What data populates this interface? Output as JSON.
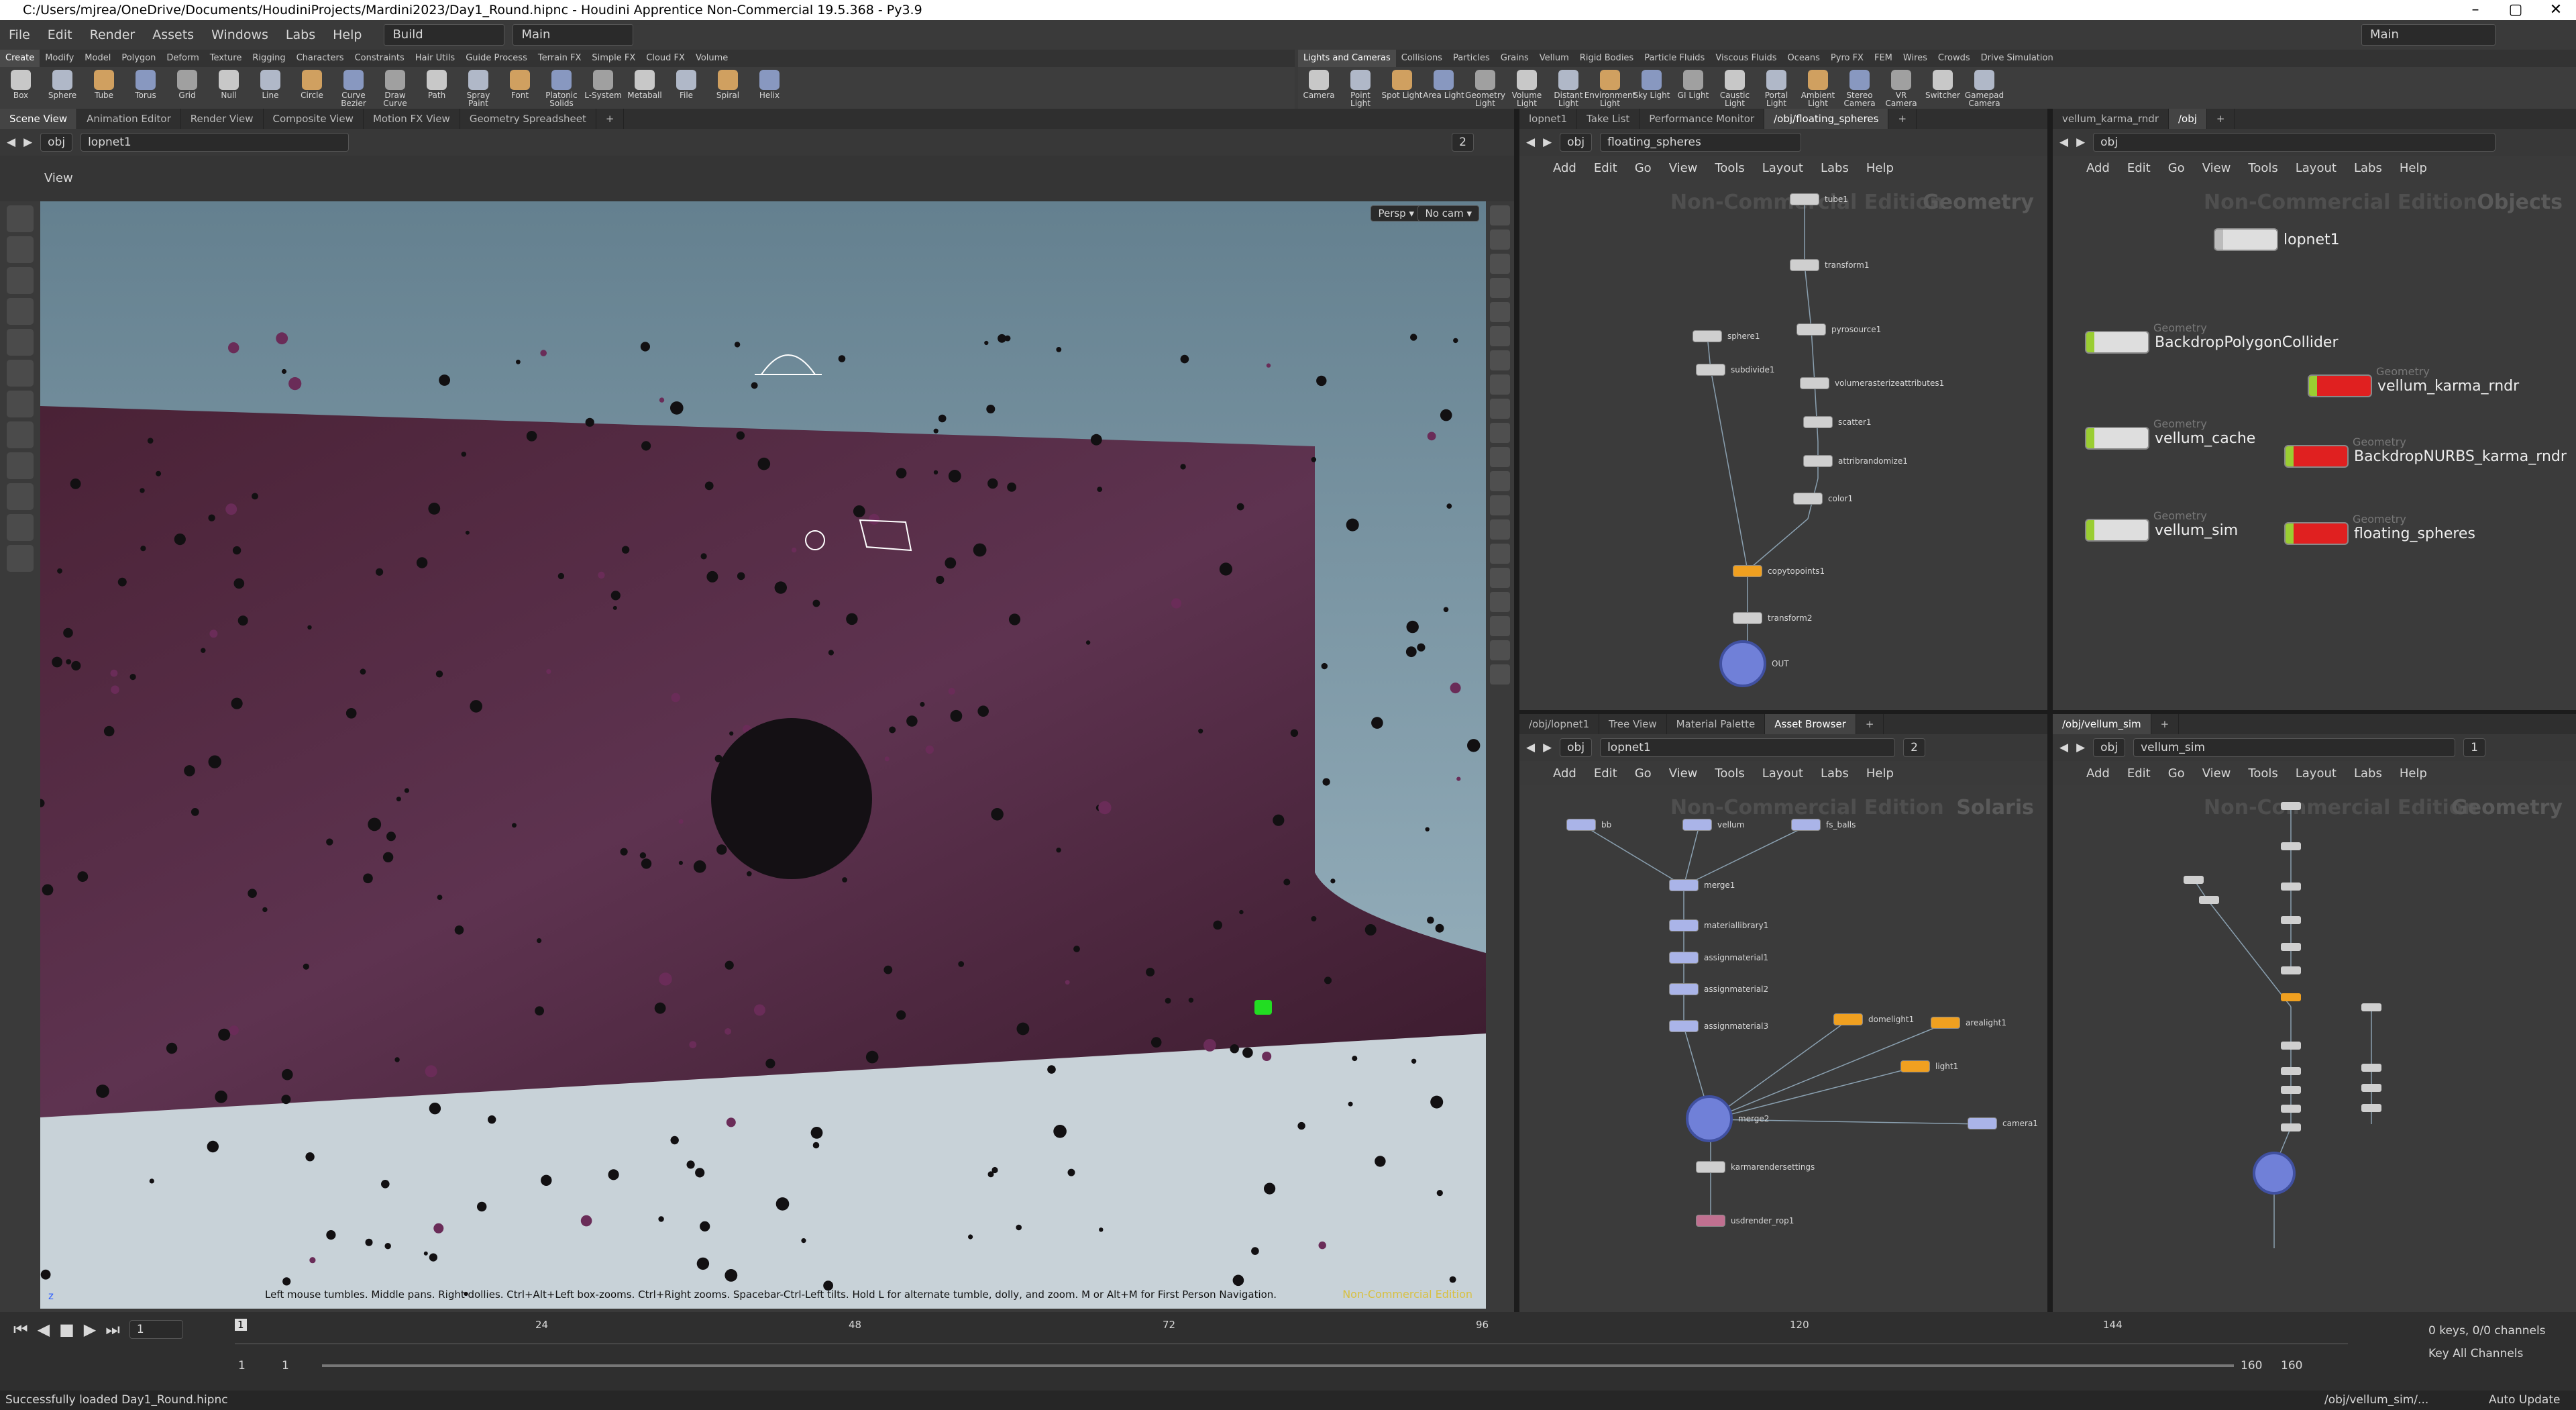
{
  "window": {
    "title": "C:/Users/mjrea/OneDrive/Documents/HoudiniProjects/Mardini2023/Day1_Round.hipnc - Houdini Apprentice Non-Commercial 19.5.368 - Py3.9",
    "minimize": "–",
    "maximize": "▢",
    "close": "✕"
  },
  "menu": {
    "items": [
      "File",
      "Edit",
      "Render",
      "Assets",
      "Windows",
      "Labs",
      "Help"
    ],
    "desktop": "Build",
    "desktop_right": "Main",
    "context": "Main"
  },
  "shelf_left": {
    "tabs": [
      "Create",
      "Modify",
      "Model",
      "Polygon",
      "Deform",
      "Texture",
      "Rigging",
      "Characters",
      "Constraints",
      "Hair Utils",
      "Guide Process",
      "Terrain FX",
      "Simple FX",
      "Cloud FX",
      "Volume"
    ],
    "tools": [
      "Box",
      "Sphere",
      "Tube",
      "Torus",
      "Grid",
      "Null",
      "Line",
      "Circle",
      "Curve Bezier",
      "Draw Curve",
      "Path",
      "Spray Paint",
      "Font",
      "Platonic Solids",
      "L-System",
      "Metaball",
      "File",
      "Spiral",
      "Helix"
    ]
  },
  "shelf_right": {
    "tabs": [
      "Lights and Cameras",
      "Collisions",
      "Particles",
      "Grains",
      "Vellum",
      "Rigid Bodies",
      "Particle Fluids",
      "Viscous Fluids",
      "Oceans",
      "Pyro FX",
      "FEM",
      "Wires",
      "Crowds",
      "Drive Simulation"
    ],
    "tools": [
      "Camera",
      "Point Light",
      "Spot Light",
      "Area Light",
      "Geometry Light",
      "Volume Light",
      "Distant Light",
      "Environment Light",
      "Sky Light",
      "GI Light",
      "Caustic Light",
      "Portal Light",
      "Ambient Light",
      "Stereo Camera",
      "VR Camera",
      "Switcher",
      "Gamepad Camera"
    ]
  },
  "viewer": {
    "tabs": [
      "Scene View",
      "Animation Editor",
      "Render View",
      "Composite View",
      "Motion FX View",
      "Geometry Spreadsheet"
    ],
    "path_obj": "obj",
    "path_node": "lopnet1",
    "title": "View",
    "persp": "Persp ▾",
    "cam": "No cam ▾",
    "hint": "Left mouse tumbles. Middle pans. Right dollies. Ctrl+Alt+Left box-zooms. Ctrl+Right zooms. Spacebar-Ctrl-Left tilts. Hold L for alternate tumble, dolly, and zoom.     M or Alt+M for First Person Navigation.",
    "watermark": "Non-Commercial Edition",
    "axis": "z",
    "pane_count": "2"
  },
  "pane_tr": {
    "tabs": [
      "lopnet1",
      "Take List",
      "Performance Monitor",
      "/obj/floating_spheres"
    ],
    "path_obj": "obj",
    "path_node": "floating_spheres",
    "menu": [
      "Add",
      "Edit",
      "Go",
      "View",
      "Tools",
      "Layout",
      "Labs",
      "Help"
    ],
    "watermark": "Non-Commercial Edition",
    "context": "Geometry",
    "nodes": [
      "tube1",
      "transform1",
      "pyrosource1",
      "volumerasterizeattributes1",
      "scatter1",
      "attribrandomize1",
      "color1",
      "sphere1",
      "subdivide1",
      "copytopoints1",
      "transform2",
      "OUT"
    ]
  },
  "pane_tr2": {
    "tabs": [
      "vellum_karma_rndr",
      "/obj"
    ],
    "path_obj": "obj",
    "menu": [
      "Add",
      "Edit",
      "Go",
      "View",
      "Tools",
      "Layout",
      "Labs",
      "Help"
    ],
    "watermark": "Non-Commercial Edition",
    "context": "Objects",
    "objects": [
      {
        "label": "lopnet1",
        "type": ""
      },
      {
        "label": "BackdropPolygonCollider",
        "type": "Geometry"
      },
      {
        "label": "vellum_karma_rndr",
        "type": "Geometry"
      },
      {
        "label": "vellum_cache",
        "type": "Geometry"
      },
      {
        "label": "BackdropNURBS_karma_rndr",
        "type": "Geometry"
      },
      {
        "label": "vellum_sim",
        "type": "Geometry"
      },
      {
        "label": "floating_spheres",
        "type": "Geometry"
      }
    ]
  },
  "pane_bl": {
    "tabs": [
      "/obj/lopnet1",
      "Tree View",
      "Material Palette",
      "Asset Browser"
    ],
    "path_obj": "obj",
    "path_node": "lopnet1",
    "pane_count": "2",
    "menu": [
      "Add",
      "Edit",
      "Go",
      "View",
      "Tools",
      "Layout",
      "Labs",
      "Help"
    ],
    "watermark": "Non-Commercial Edition",
    "context": "Solaris",
    "nodes": [
      "bb",
      "vellum",
      "fs_balls",
      "merge1",
      "materiallibrary1",
      "assignmaterial1",
      "assignmaterial2",
      "assignmaterial3",
      "domelight1",
      "arealight1",
      "light1",
      "camera1",
      "merge2",
      "karmarendersettings",
      "usdrender_rop1"
    ]
  },
  "pane_br": {
    "tabs": [
      "/obj/vellum_sim"
    ],
    "path_obj": "obj",
    "path_node": "vellum_sim",
    "pane_count": "1",
    "menu": [
      "Add",
      "Edit",
      "Go",
      "View",
      "Tools",
      "Layout",
      "Labs",
      "Help"
    ],
    "watermark": "Non-Commercial Edition",
    "context": "Geometry"
  },
  "timeline": {
    "ticks": [
      "1",
      "24",
      "48",
      "72",
      "96",
      "120",
      "144"
    ],
    "frame": "1",
    "start": "1",
    "start2": "1",
    "end": "160",
    "end2": "160",
    "keys": "0 keys, 0/0 channels",
    "key_channels": "Key All Channels",
    "auto_update": "Auto Update",
    "path": "/obj/vellum_sim/..."
  },
  "status": "Successfully loaded Day1_Round.hipnc"
}
